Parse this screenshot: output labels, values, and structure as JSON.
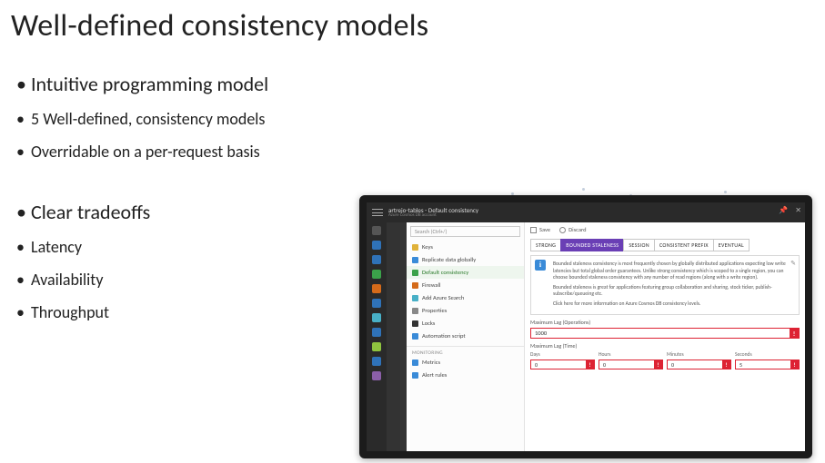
{
  "title": "Well-defined consistency models",
  "bullets_a": {
    "b1": "Intuitive programming model",
    "b2": "5 Well-defined, consistency models",
    "b3": "Overridable on a per-request basis"
  },
  "bullets_b": {
    "b1": "Clear tradeoffs",
    "b2": "Latency",
    "b3": "Availability",
    "b4": "Throughput"
  },
  "azure": {
    "header": {
      "title": "artrejo-tables - Default consistency",
      "subtitle": "Azure Cosmos DB account",
      "pin": "📌",
      "close": "✕"
    },
    "search_placeholder": "Search (Ctrl+/)",
    "resources": {
      "keys": "Keys",
      "replicate": "Replicate data globally",
      "default_consistency": "Default consistency",
      "firewall": "Firewall",
      "add_search": "Add Azure Search",
      "properties": "Properties",
      "locks": "Locks",
      "automation": "Automation script",
      "monitoring_head": "Monitoring",
      "metrics": "Metrics",
      "alerts": "Alert rules"
    },
    "commands": {
      "save": "Save",
      "discard": "Discard"
    },
    "tabs": {
      "strong": "STRONG",
      "bounded": "BOUNDED STALENESS",
      "session": "SESSION",
      "consistent_prefix": "CONSISTENT PREFIX",
      "eventual": "EVENTUAL"
    },
    "info": {
      "p1": "Bounded staleness consistency is most frequently chosen by globally distributed applications expecting low write latencies but total global order guarantees. Unlike strong consistency which is scoped to a single region, you can choose bounded staleness consistency with any number of read regions (along with a write region).",
      "p2": "Bounded staleness is great for applications featuring group collaboration and sharing, stock ticker, publish-subscribe/queueing etc.",
      "p3": "Click here for more information on Azure Cosmos DB consistency levels."
    },
    "fields": {
      "max_lag_ops_label": "Maximum Lag (Operations)",
      "max_lag_ops_value": "1000",
      "max_lag_time_label": "Maximum Lag (Time)",
      "days_label": "Days",
      "days_value": "0",
      "hours_label": "Hours",
      "hours_value": "0",
      "minutes_label": "Minutes",
      "minutes_value": "0",
      "seconds_label": "Seconds",
      "seconds_value": "5"
    }
  }
}
